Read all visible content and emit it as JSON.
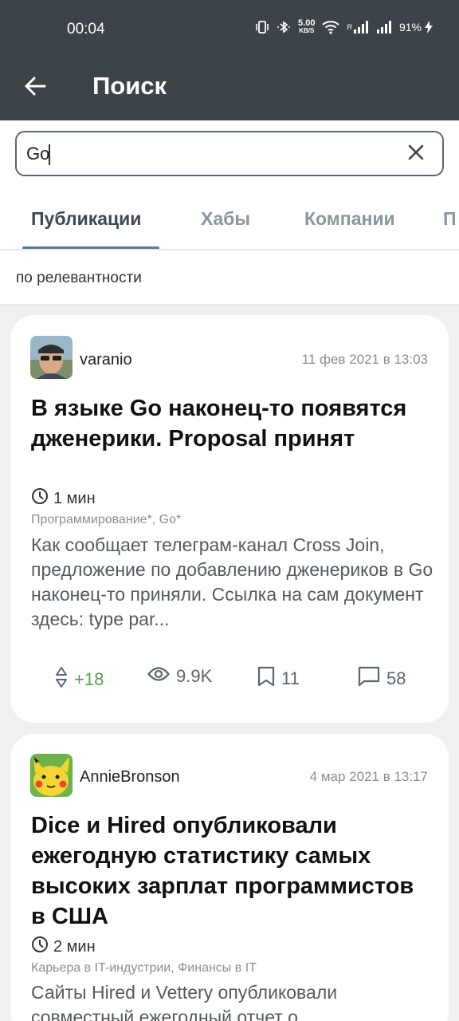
{
  "status_bar": {
    "time": "00:04",
    "net_speed": "5.00",
    "net_unit": "KB/S",
    "signal_r": "R",
    "battery": "91%",
    "icons": [
      "vibrate-icon",
      "bluetooth-icon",
      "wifi-icon",
      "signal-icon",
      "signal-icon",
      "charging-icon"
    ]
  },
  "app_bar": {
    "title": "Поиск",
    "back_icon": "arrow-left-icon"
  },
  "search": {
    "value": "Go",
    "clear_icon": "close-icon"
  },
  "tabs": [
    {
      "label": "Публикации",
      "active": true
    },
    {
      "label": "Хабы",
      "active": false
    },
    {
      "label": "Компании",
      "active": false
    },
    {
      "label": "П",
      "active": false
    }
  ],
  "sort": {
    "label": "по релевантности"
  },
  "articles": [
    {
      "author": "varanio",
      "date": "11 фев 2021 в 13:03",
      "title": "В языке Go наконец-то появятся дженерики. Proposal принят",
      "read_time": "1 мин",
      "hubs": "Программирование*, Go*",
      "excerpt": "Как сообщает телеграм-канал Cross Join, предложение по добавлению дженериков в Go наконец-то приняли. Ссылка на сам документ здесь: type par...",
      "votes": "+18",
      "views": "9.9K",
      "bookmarks": "11",
      "comments": "58"
    },
    {
      "author": "AnnieBronson",
      "date": "4 мар 2021 в 13:17",
      "title": "Dice и Hired опубликовали ежегодную статистику самых высоких зарплат программистов в США",
      "read_time": "2 мин",
      "hubs": "Карьера в IT-индустрии, Финансы в IT",
      "excerpt": "Сайты Hired и Vettery опубликовали совместный ежегодный отчет о"
    }
  ],
  "colors": {
    "app_bar": "#3c4349",
    "votes_positive": "#56a04a",
    "tab_active": "#3d4a54",
    "tab_inactive": "#8a969e"
  }
}
